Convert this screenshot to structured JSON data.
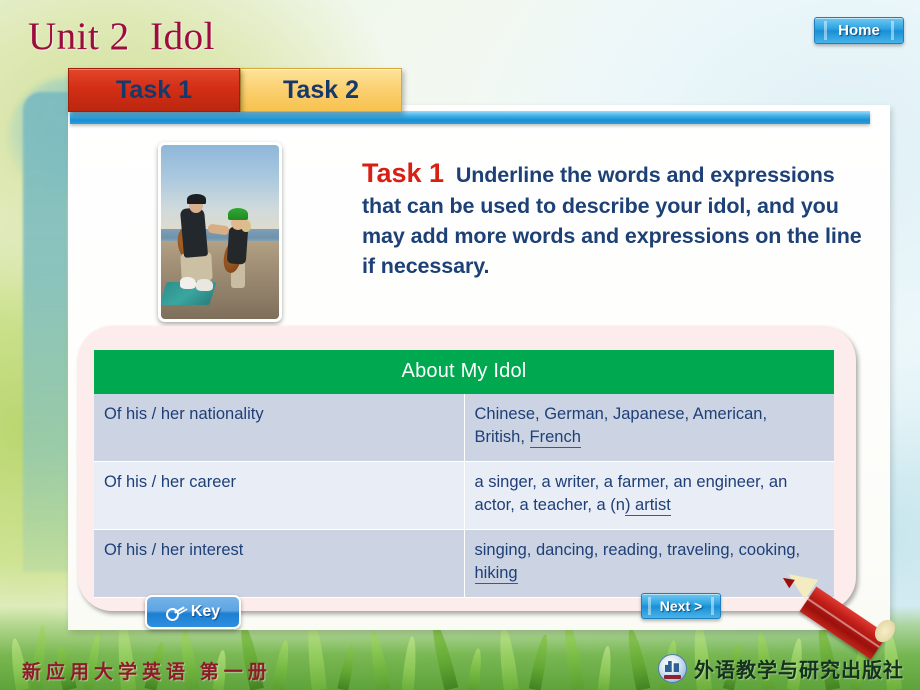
{
  "header": {
    "unit_title": "Unit 2  Idol",
    "home_label": "Home"
  },
  "tabs": [
    {
      "label": "Task 1",
      "state": "active",
      "color": "#d32f16"
    },
    {
      "label": "Task 2",
      "state": "inactive",
      "color": "#f7c24e"
    }
  ],
  "task": {
    "label": "Task 1",
    "instruction": "Underline the words and expressions that can be used to describe your idol, and you may add more words and expressions on the line if necessary."
  },
  "photo": {
    "alt": "A man playing guitar kneeling on a beach with a child wearing a green cap holding a small guitar"
  },
  "table": {
    "title": "About My Idol",
    "header_color": "#00a84f",
    "rows": [
      {
        "label": "Of his / her nationality",
        "value_plain": "Chinese, German, Japanese, American, British, ",
        "value_underlined": "French  "
      },
      {
        "label": "Of his / her career",
        "value_plain": "a singer, a writer, a farmer, an engineer, an actor, a teacher, a (n",
        "value_underlined": ") artist  "
      },
      {
        "label": "Of his / her interest",
        "value_plain": "singing, dancing, reading, traveling, cooking, ",
        "value_underlined": "hiking   "
      }
    ]
  },
  "buttons": {
    "key_label": "Key",
    "next_label": "Next >"
  },
  "footer": {
    "left_text": "新应用大学英语 第一册",
    "publisher": "外语教学与研究出版社"
  },
  "colors": {
    "title_red": "#9e0b3f",
    "task_label_red": "#d81f14",
    "body_navy": "#1d4176",
    "table_header_green": "#00a84f",
    "row_shade_a": "#ccd4e3",
    "row_shade_b": "#e9edf6",
    "pink_panel": "#fdecec",
    "accent_blue": "#1c8ed2"
  }
}
